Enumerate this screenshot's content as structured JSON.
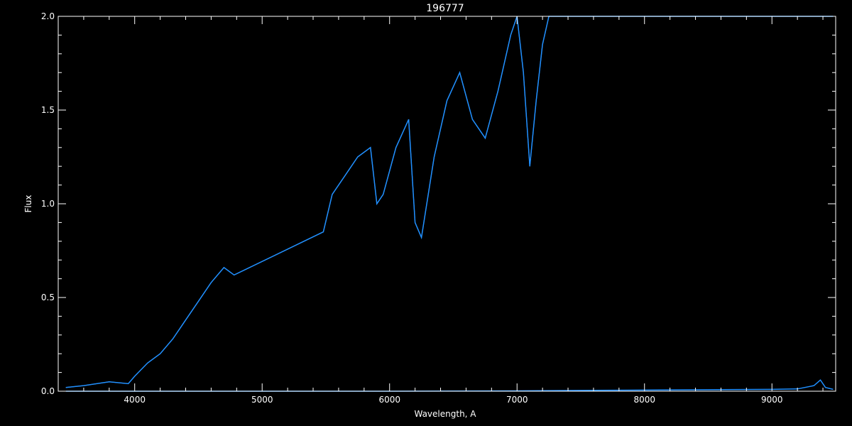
{
  "chart_data": {
    "type": "line",
    "title": "196777",
    "xlabel": "Wavelength, A",
    "ylabel": "Flux",
    "xlim": [
      3400,
      9500
    ],
    "ylim": [
      0.0,
      2.0
    ],
    "x_ticks": [
      4000,
      5000,
      6000,
      7000,
      8000,
      9000
    ],
    "x_tick_labels": [
      "4000",
      "5000",
      "6000",
      "7000",
      "8000",
      "9000"
    ],
    "y_ticks": [
      0.0,
      0.5,
      1.0,
      1.5,
      2.0
    ],
    "y_tick_labels": [
      "0.0",
      "0.5",
      "1.0",
      "1.5",
      "2.0"
    ],
    "grid": false,
    "background_color": "#000000",
    "axis_color": "#ffffff",
    "series": [
      {
        "color": "#ffffff",
        "x": [
          3460,
          3600,
          3800,
          3950,
          4000,
          4100,
          4200,
          4300,
          4400,
          4500,
          4600,
          4700,
          4780,
          5480,
          5550,
          5650,
          5750,
          5850,
          5900,
          5950,
          6050,
          6150,
          6200,
          6250,
          6350,
          6450,
          6550,
          6650,
          6750,
          6850,
          6950,
          7000,
          7050,
          7100,
          7150,
          7200,
          7250,
          7300,
          7500,
          7700,
          7900,
          8100,
          8300,
          8500,
          8700,
          8900,
          9100,
          9300,
          9480
        ],
        "y": [
          0.02,
          0.03,
          0.05,
          0.04,
          0.08,
          0.15,
          0.2,
          0.28,
          0.38,
          0.48,
          0.58,
          0.66,
          0.62,
          0.85,
          1.05,
          1.15,
          1.25,
          1.3,
          1.0,
          1.05,
          1.3,
          1.45,
          0.9,
          0.82,
          1.25,
          1.55,
          1.7,
          1.45,
          1.35,
          1.6,
          1.9,
          2.0,
          1.7,
          1.2,
          1.55,
          1.85,
          2.0,
          2.0,
          2.0,
          2.0,
          2.0,
          2.0,
          2.0,
          2.0,
          2.0,
          2.0,
          2.0,
          2.0,
          2.0
        ]
      },
      {
        "color": "#1f8fff",
        "x": [
          3460,
          3600,
          3800,
          3950,
          4000,
          4100,
          4200,
          4300,
          4400,
          4500,
          4600,
          4700,
          4780,
          5480,
          5550,
          5650,
          5750,
          5850,
          5900,
          5950,
          6050,
          6150,
          6200,
          6250,
          6350,
          6450,
          6550,
          6650,
          6750,
          6850,
          6950,
          7000,
          7050,
          7100,
          7150,
          7200,
          7250,
          7300,
          7500,
          7700,
          7900,
          8100,
          8300,
          8500,
          8700,
          8900,
          9100,
          9300,
          9480
        ],
        "y": [
          0.02,
          0.03,
          0.05,
          0.04,
          0.08,
          0.15,
          0.2,
          0.28,
          0.38,
          0.48,
          0.58,
          0.66,
          0.62,
          0.85,
          1.05,
          1.15,
          1.25,
          1.3,
          1.0,
          1.05,
          1.3,
          1.45,
          0.9,
          0.82,
          1.25,
          1.55,
          1.7,
          1.45,
          1.35,
          1.6,
          1.9,
          2.0,
          1.7,
          1.2,
          1.55,
          1.85,
          2.0,
          2.0,
          2.0,
          2.0,
          2.0,
          2.0,
          2.0,
          2.0,
          2.0,
          2.0,
          2.0,
          2.0,
          2.0
        ]
      },
      {
        "color": "#1f8fff",
        "x": [
          3460,
          4000,
          5000,
          6000,
          7000,
          7600,
          8000,
          8500,
          9000,
          9200,
          9330,
          9380,
          9420,
          9480
        ],
        "y": [
          0.0,
          0.0,
          0.0,
          0.0,
          0.002,
          0.005,
          0.006,
          0.008,
          0.01,
          0.012,
          0.03,
          0.06,
          0.02,
          0.01
        ]
      }
    ]
  }
}
